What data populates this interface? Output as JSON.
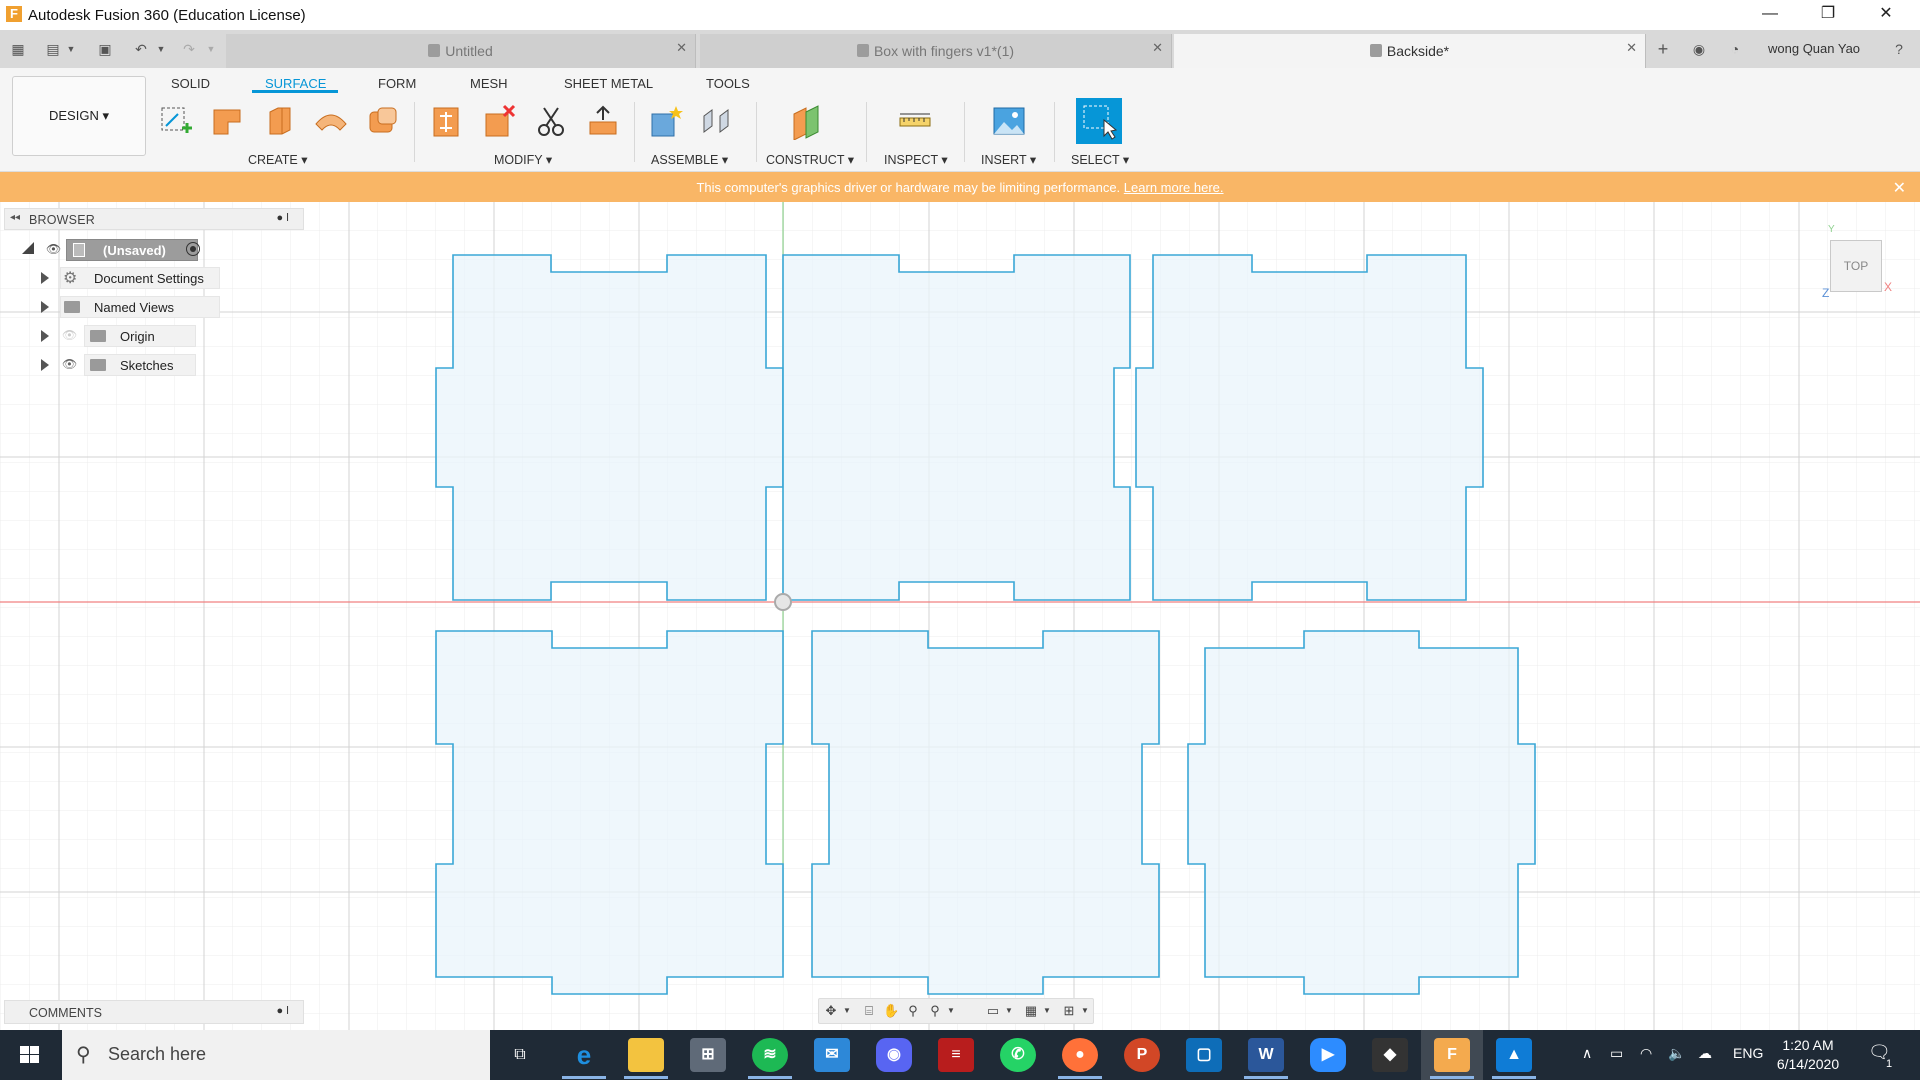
{
  "window": {
    "app_icon": "F",
    "title": "Autodesk Fusion 360 (Education License)",
    "controls": [
      "—",
      "❐",
      "✕"
    ]
  },
  "tabs": [
    {
      "label": "Untitled",
      "active": false
    },
    {
      "label": "Box with fingers v1*(1)",
      "active": false
    },
    {
      "label": "Backside*",
      "active": true
    }
  ],
  "user": {
    "name": "wong Quan Yao"
  },
  "toolbar": {
    "workspace": "DESIGN ▾",
    "workspace_tabs": [
      "SOLID",
      "SURFACE",
      "FORM",
      "MESH",
      "SHEET METAL",
      "TOOLS"
    ],
    "active_tab": "SURFACE",
    "groups": {
      "create": "CREATE ▾",
      "modify": "MODIFY ▾",
      "assemble": "ASSEMBLE ▾",
      "construct": "CONSTRUCT ▾",
      "inspect": "INSPECT ▾",
      "insert": "INSERT ▾",
      "select": "SELECT ▾"
    }
  },
  "banner": {
    "message": "This computer's graphics driver or hardware may be limiting performance.",
    "link": "Learn more here.",
    "close": "✕"
  },
  "browser": {
    "title": "BROWSER",
    "root": "(Unsaved)",
    "items": [
      "Document Settings",
      "Named Views",
      "Origin",
      "Sketches"
    ]
  },
  "comments": {
    "title": "COMMENTS"
  },
  "viewcube": {
    "label": "TOP",
    "axis_y": "Y",
    "axis_x": "X",
    "axis_z": "Z"
  },
  "colors": {
    "accent": "#0696d7",
    "banner": "#f9b666",
    "sketch_line": "#3aa7d6",
    "sketch_fill": "#eaf4fb",
    "x_axis": "#f08080",
    "y_axis": "#8fd18f",
    "taskbar": "#1f2a36"
  },
  "taskbar": {
    "search_placeholder": "Search here",
    "apps": [
      "task-view",
      "edge",
      "file-explorer",
      "store",
      "spotify",
      "mail",
      "discord",
      "game-app",
      "whatsapp",
      "firefox",
      "powerpoint",
      "notes-app",
      "word",
      "zoom",
      "inkscape",
      "fusion-360",
      "photos"
    ],
    "language": "ENG",
    "time": "1:20 AM",
    "date": "6/14/2020",
    "notifications": "1"
  }
}
